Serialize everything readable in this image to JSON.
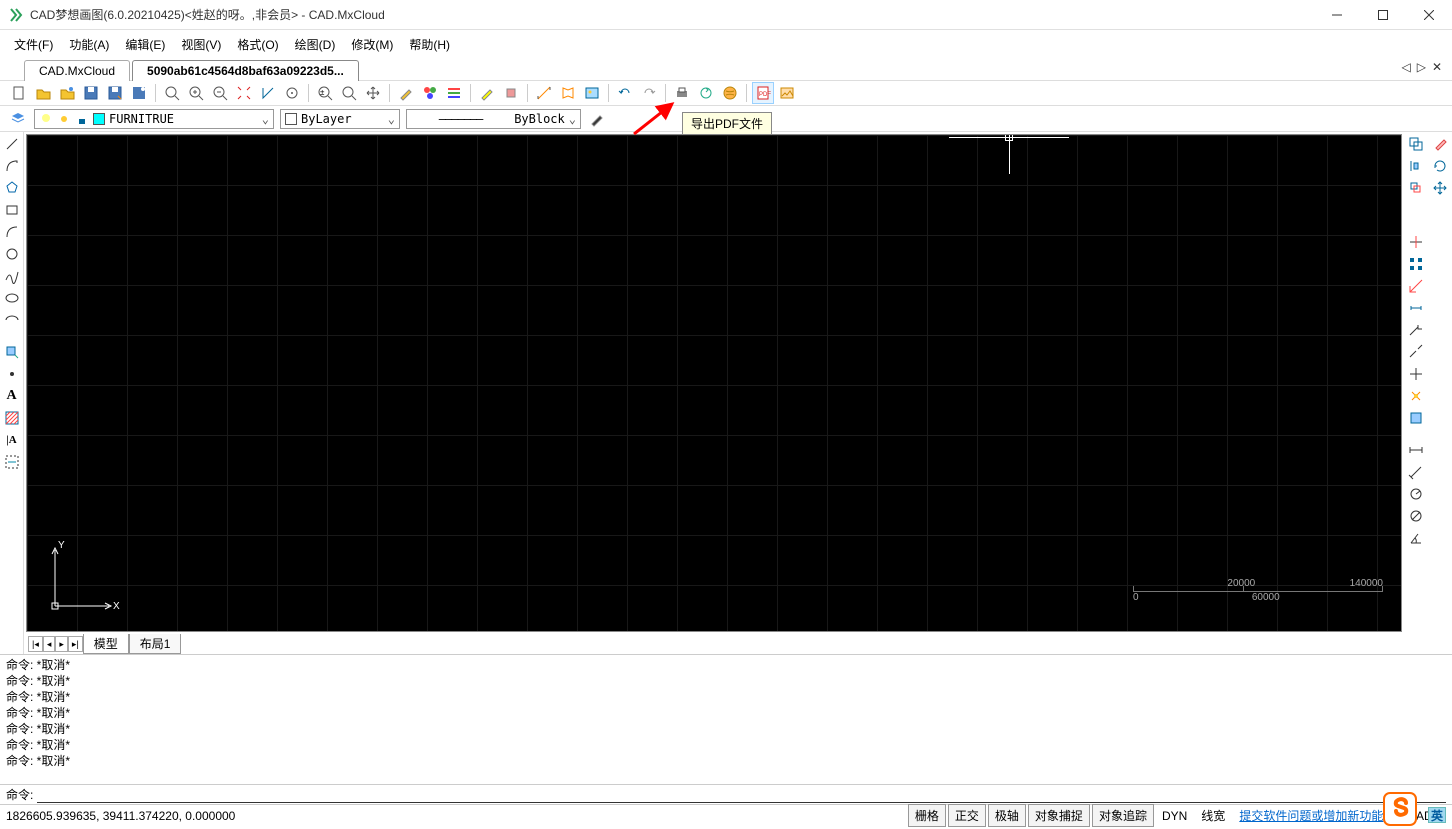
{
  "title": "CAD梦想画图(6.0.20210425)<姓赵的呀。,非会员> - CAD.MxCloud",
  "menus": [
    "文件(F)",
    "功能(A)",
    "编辑(E)",
    "视图(V)",
    "格式(O)",
    "绘图(D)",
    "修改(M)",
    "帮助(H)"
  ],
  "tabs": [
    "CAD.MxCloud",
    "5090ab61c4564d8baf63a09223d5..."
  ],
  "activeTab": 1,
  "tooltip": "导出PDF文件",
  "layer": "FURNITRUE",
  "colorName": "ByLayer",
  "linetype": "ByBlock",
  "scale": {
    "mid": "20000",
    "right": "140000",
    "b0": "0",
    "b1": "60000"
  },
  "layoutTabs": [
    "模型",
    "布局1"
  ],
  "cmdHistory": [
    "命令:   *取消*",
    "命令:   *取消*",
    "命令:   *取消*",
    "命令:   *取消*",
    "命令:   *取消*",
    "命令:   *取消*",
    "命令:   *取消*"
  ],
  "cmdPrompt": "命令:",
  "coords": "1826605.939635,  39411.374220,  0.000000",
  "statusToggles": [
    "栅格",
    "正交",
    "极轴",
    "对象捕捉",
    "对象追踪"
  ],
  "statusText": [
    "DYN",
    "线宽"
  ],
  "feedbackLink": "提交软件问题或增加新功能",
  "statusFile": "CAD.M",
  "ime": "英"
}
